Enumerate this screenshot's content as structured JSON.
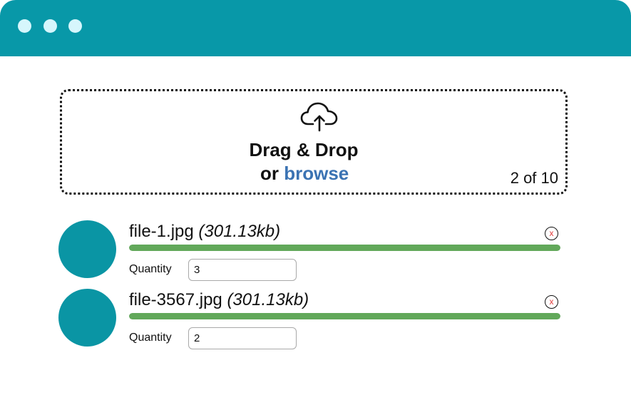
{
  "window": {
    "controls": [
      "window-dot-1",
      "window-dot-2",
      "window-dot-3"
    ]
  },
  "dropzone": {
    "title": "Drag & Drop",
    "or_text": "or",
    "browse_label": "browse",
    "counter": "2 of 10",
    "icon": "cloud-upload-icon"
  },
  "files": [
    {
      "name": "file-1.jpg",
      "size": "(301.13kb)",
      "progress_percent": 100,
      "quantity_label": "Quantity",
      "quantity": "3",
      "remove_label": "x"
    },
    {
      "name": "file-3567.jpg",
      "size": "(301.13kb)",
      "progress_percent": 100,
      "quantity_label": "Quantity",
      "quantity": "2",
      "remove_label": "x"
    }
  ],
  "colors": {
    "titlebar": "#0898a8",
    "avatar": "#0a95a4",
    "progress": "#62a85a",
    "browse_link": "#3b73b3",
    "remove_x": "#e23a3a"
  }
}
